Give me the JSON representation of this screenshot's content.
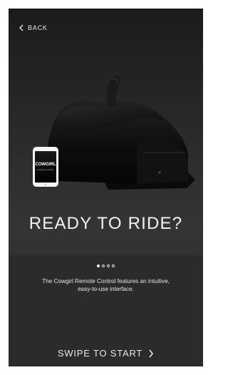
{
  "nav": {
    "back_label": "BACK"
  },
  "phone_brand": "COWGIRL",
  "phone_tagline": "premium sex machine",
  "headline": "READY TO RIDE?",
  "pagination": {
    "total": 4,
    "active": 1
  },
  "description": "The Cowgirl Remote Control features an intuitive, easy-to-use interface.",
  "cta": {
    "label": "SWIPE TO START"
  },
  "colors": {
    "background": "#2a2a2a",
    "text": "#f2f2f2",
    "device": "#0d0d0d"
  }
}
